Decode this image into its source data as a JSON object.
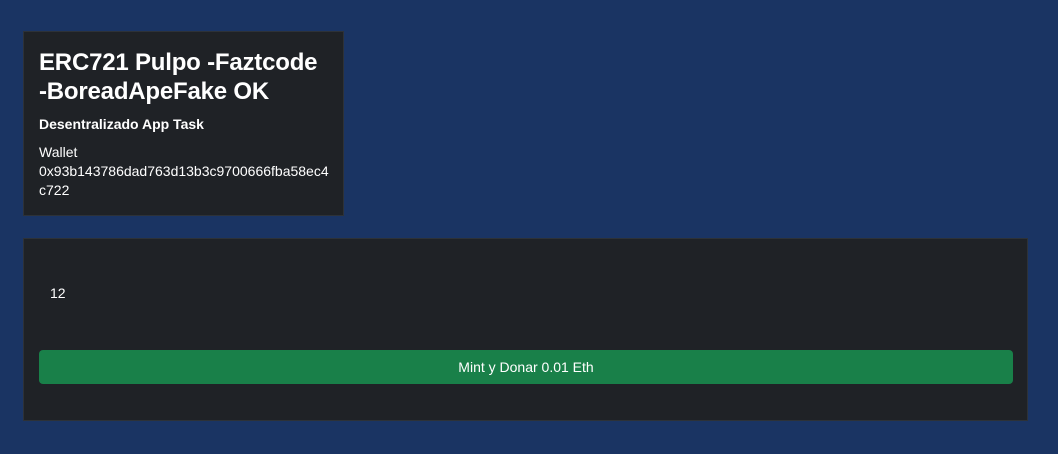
{
  "info": {
    "title": "ERC721 Pulpo -Faztcode -BoreadApeFake OK",
    "subtitle": "Desentralizado App Task",
    "wallet_label": "Wallet",
    "wallet_address": "0x93b143786dad763d13b3c9700666fba58ec4c722"
  },
  "mint": {
    "count": "12",
    "button_label": "Mint y Donar 0.01 Eth"
  },
  "colors": {
    "background": "#1a3463",
    "card": "#1f2226",
    "button": "#198049"
  }
}
